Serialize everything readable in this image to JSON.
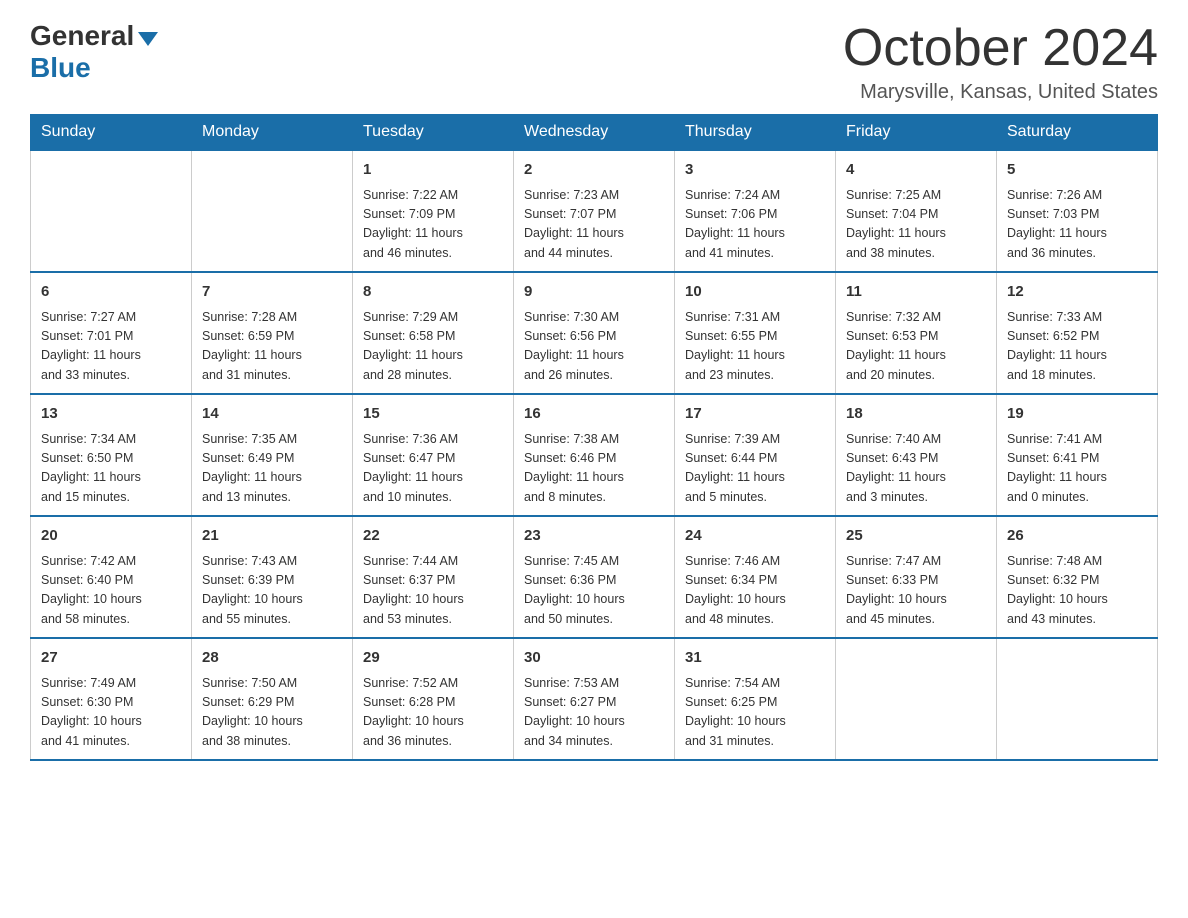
{
  "header": {
    "logo_general": "General",
    "logo_blue": "Blue",
    "month_title": "October 2024",
    "location": "Marysville, Kansas, United States"
  },
  "days_of_week": [
    "Sunday",
    "Monday",
    "Tuesday",
    "Wednesday",
    "Thursday",
    "Friday",
    "Saturday"
  ],
  "weeks": [
    [
      {
        "day": "",
        "info": ""
      },
      {
        "day": "",
        "info": ""
      },
      {
        "day": "1",
        "info": "Sunrise: 7:22 AM\nSunset: 7:09 PM\nDaylight: 11 hours\nand 46 minutes."
      },
      {
        "day": "2",
        "info": "Sunrise: 7:23 AM\nSunset: 7:07 PM\nDaylight: 11 hours\nand 44 minutes."
      },
      {
        "day": "3",
        "info": "Sunrise: 7:24 AM\nSunset: 7:06 PM\nDaylight: 11 hours\nand 41 minutes."
      },
      {
        "day": "4",
        "info": "Sunrise: 7:25 AM\nSunset: 7:04 PM\nDaylight: 11 hours\nand 38 minutes."
      },
      {
        "day": "5",
        "info": "Sunrise: 7:26 AM\nSunset: 7:03 PM\nDaylight: 11 hours\nand 36 minutes."
      }
    ],
    [
      {
        "day": "6",
        "info": "Sunrise: 7:27 AM\nSunset: 7:01 PM\nDaylight: 11 hours\nand 33 minutes."
      },
      {
        "day": "7",
        "info": "Sunrise: 7:28 AM\nSunset: 6:59 PM\nDaylight: 11 hours\nand 31 minutes."
      },
      {
        "day": "8",
        "info": "Sunrise: 7:29 AM\nSunset: 6:58 PM\nDaylight: 11 hours\nand 28 minutes."
      },
      {
        "day": "9",
        "info": "Sunrise: 7:30 AM\nSunset: 6:56 PM\nDaylight: 11 hours\nand 26 minutes."
      },
      {
        "day": "10",
        "info": "Sunrise: 7:31 AM\nSunset: 6:55 PM\nDaylight: 11 hours\nand 23 minutes."
      },
      {
        "day": "11",
        "info": "Sunrise: 7:32 AM\nSunset: 6:53 PM\nDaylight: 11 hours\nand 20 minutes."
      },
      {
        "day": "12",
        "info": "Sunrise: 7:33 AM\nSunset: 6:52 PM\nDaylight: 11 hours\nand 18 minutes."
      }
    ],
    [
      {
        "day": "13",
        "info": "Sunrise: 7:34 AM\nSunset: 6:50 PM\nDaylight: 11 hours\nand 15 minutes."
      },
      {
        "day": "14",
        "info": "Sunrise: 7:35 AM\nSunset: 6:49 PM\nDaylight: 11 hours\nand 13 minutes."
      },
      {
        "day": "15",
        "info": "Sunrise: 7:36 AM\nSunset: 6:47 PM\nDaylight: 11 hours\nand 10 minutes."
      },
      {
        "day": "16",
        "info": "Sunrise: 7:38 AM\nSunset: 6:46 PM\nDaylight: 11 hours\nand 8 minutes."
      },
      {
        "day": "17",
        "info": "Sunrise: 7:39 AM\nSunset: 6:44 PM\nDaylight: 11 hours\nand 5 minutes."
      },
      {
        "day": "18",
        "info": "Sunrise: 7:40 AM\nSunset: 6:43 PM\nDaylight: 11 hours\nand 3 minutes."
      },
      {
        "day": "19",
        "info": "Sunrise: 7:41 AM\nSunset: 6:41 PM\nDaylight: 11 hours\nand 0 minutes."
      }
    ],
    [
      {
        "day": "20",
        "info": "Sunrise: 7:42 AM\nSunset: 6:40 PM\nDaylight: 10 hours\nand 58 minutes."
      },
      {
        "day": "21",
        "info": "Sunrise: 7:43 AM\nSunset: 6:39 PM\nDaylight: 10 hours\nand 55 minutes."
      },
      {
        "day": "22",
        "info": "Sunrise: 7:44 AM\nSunset: 6:37 PM\nDaylight: 10 hours\nand 53 minutes."
      },
      {
        "day": "23",
        "info": "Sunrise: 7:45 AM\nSunset: 6:36 PM\nDaylight: 10 hours\nand 50 minutes."
      },
      {
        "day": "24",
        "info": "Sunrise: 7:46 AM\nSunset: 6:34 PM\nDaylight: 10 hours\nand 48 minutes."
      },
      {
        "day": "25",
        "info": "Sunrise: 7:47 AM\nSunset: 6:33 PM\nDaylight: 10 hours\nand 45 minutes."
      },
      {
        "day": "26",
        "info": "Sunrise: 7:48 AM\nSunset: 6:32 PM\nDaylight: 10 hours\nand 43 minutes."
      }
    ],
    [
      {
        "day": "27",
        "info": "Sunrise: 7:49 AM\nSunset: 6:30 PM\nDaylight: 10 hours\nand 41 minutes."
      },
      {
        "day": "28",
        "info": "Sunrise: 7:50 AM\nSunset: 6:29 PM\nDaylight: 10 hours\nand 38 minutes."
      },
      {
        "day": "29",
        "info": "Sunrise: 7:52 AM\nSunset: 6:28 PM\nDaylight: 10 hours\nand 36 minutes."
      },
      {
        "day": "30",
        "info": "Sunrise: 7:53 AM\nSunset: 6:27 PM\nDaylight: 10 hours\nand 34 minutes."
      },
      {
        "day": "31",
        "info": "Sunrise: 7:54 AM\nSunset: 6:25 PM\nDaylight: 10 hours\nand 31 minutes."
      },
      {
        "day": "",
        "info": ""
      },
      {
        "day": "",
        "info": ""
      }
    ]
  ]
}
